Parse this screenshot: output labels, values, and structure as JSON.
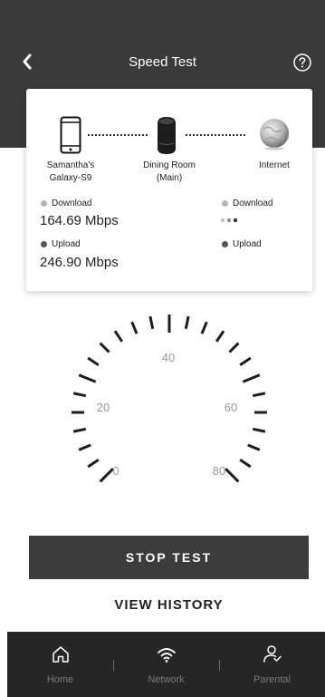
{
  "header": {
    "title": "Speed Test",
    "back_icon": "chevron-left-icon",
    "help_icon": "question-circle-icon"
  },
  "topology": {
    "left_device": {
      "name_line1": "Samantha's",
      "name_line2": "Galaxy-S9",
      "icon": "phone-icon"
    },
    "middle_device": {
      "name_line1": "Dining Room",
      "name_line2": "(Main)",
      "icon": "router-icon"
    },
    "right_device": {
      "name": "Internet",
      "icon": "globe-icon"
    }
  },
  "results": {
    "left": {
      "download_label": "Download",
      "download_value": "164.69 Mbps",
      "upload_label": "Upload",
      "upload_value": "246.90 Mbps"
    },
    "right": {
      "download_label": "Download",
      "upload_label": "Upload",
      "loading_icon": "loading-dots-icon"
    }
  },
  "gauge": {
    "labels": [
      "0",
      "20",
      "40",
      "60",
      "80"
    ]
  },
  "actions": {
    "stop_test": "STOP TEST",
    "view_history": "VIEW HISTORY"
  },
  "tabs": [
    {
      "label": "Home",
      "icon": "home-icon"
    },
    {
      "label": "Network",
      "icon": "wifi-icon"
    },
    {
      "label": "Parental",
      "icon": "parental-icon"
    }
  ],
  "colors": {
    "header_bg": "#3a3a3a",
    "button_bg": "#3c3c3c",
    "tabbar_bg": "#262626",
    "download_bullet": "#b5b5b5",
    "upload_bullet": "#555555"
  }
}
